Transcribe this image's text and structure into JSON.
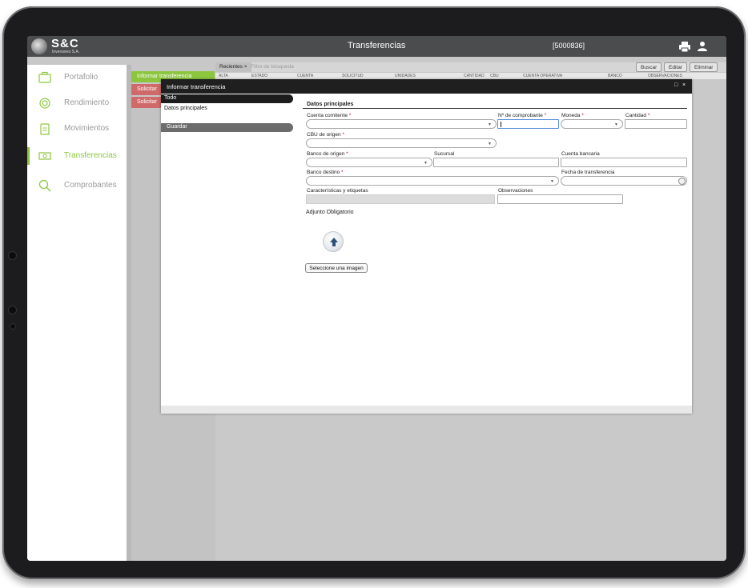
{
  "app": {
    "logo_text": "S&C",
    "logo_subtext": "Inversores S.A.",
    "title": "Transferencias",
    "user_id": "[5000836]"
  },
  "icons": {
    "print": "print-icon",
    "user": "user-icon"
  },
  "colors": {
    "accent": "#8cc63f",
    "topbar": "#4a4c4e",
    "action_green": "#8cc63f",
    "action_red": "#d06a6a",
    "required": "#d0021b"
  },
  "sidebar": {
    "items": [
      {
        "label": "Portafolio",
        "icon": "briefcase-icon",
        "active": false
      },
      {
        "label": "Rendimiento",
        "icon": "chart-ring-icon",
        "active": false
      },
      {
        "label": "Movimientos",
        "icon": "clipboard-icon",
        "active": false
      },
      {
        "label": "Transferencias",
        "icon": "money-transfer-icon",
        "active": true
      },
      {
        "label": "Comprobantes",
        "icon": "search-icon",
        "active": false
      }
    ]
  },
  "background": {
    "actions": [
      "Informar transferencia",
      "Solicitar",
      "Solicitar"
    ],
    "recent_tab": "Recientes ×",
    "filter_placeholder": "Filtro de búsqueda",
    "buttons": [
      "Buscar",
      "Editar",
      "Eliminar"
    ],
    "columns": [
      "ALTA",
      "ESTADO",
      "CUENTA",
      "SOLICITUD",
      "UNIDADES",
      "CANTIDAD",
      "CBU",
      "CUENTA OPERATIVA",
      "BANCO",
      "OBSERVACIONES"
    ]
  },
  "modal": {
    "title": "Informar transferencia",
    "maximize": "□",
    "close": "×",
    "left_tab_all": "Todo",
    "left_link": "Datos principales",
    "save_label": "Guardar",
    "section_title": "Datos principales",
    "fields": {
      "cuenta_comitente": {
        "label": "Cuenta comitente",
        "required": "*",
        "value": ""
      },
      "nro_comprobante": {
        "label": "Nº de comprobante",
        "required": "*",
        "value": ""
      },
      "moneda": {
        "label": "Moneda",
        "required": "*",
        "value": ""
      },
      "cantidad": {
        "label": "Cantidad",
        "required": "*",
        "value": ""
      },
      "cbu_origen": {
        "label": "CBU de origen",
        "required": "*",
        "value": ""
      },
      "banco_origen": {
        "label": "Banco de origen",
        "required": "*",
        "value": ""
      },
      "sucursal": {
        "label": "Sucursal",
        "value": ""
      },
      "cuenta_bancaria": {
        "label": "Cuenta bancaria",
        "value": ""
      },
      "banco_destino": {
        "label": "Banco destino",
        "required": "*",
        "value": ""
      },
      "fecha_transferencia": {
        "label": "Fecha de transferencia",
        "value": ""
      },
      "caracteristicas": {
        "label": "Características y etiquetas",
        "value": ""
      },
      "observaciones": {
        "label": "Observaciones",
        "value": ""
      }
    },
    "attachment_label": "Adjunto Obligatorio",
    "select_image_label": "Seleccione una imagen"
  }
}
